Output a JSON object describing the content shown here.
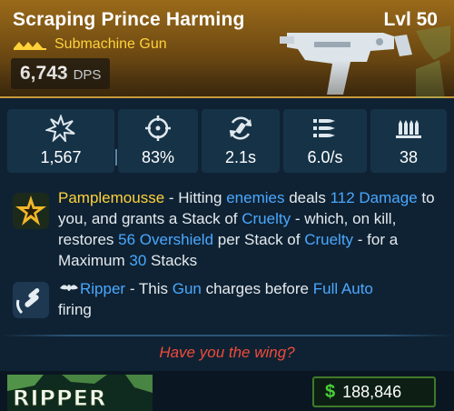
{
  "header": {
    "name": "Scraping Prince Harming",
    "level": "Lvl 50",
    "rarity_label": "Submachine Gun",
    "dps_value": "6,743",
    "dps_unit": "DPS"
  },
  "stats": [
    {
      "icon": "damage-burst-icon",
      "value": "1,567"
    },
    {
      "icon": "crosshair-icon",
      "value": "83%"
    },
    {
      "icon": "reload-icon",
      "value": "2.1s"
    },
    {
      "icon": "fire-rate-icon",
      "value": "6.0/s"
    },
    {
      "icon": "magazine-icon",
      "value": "38"
    }
  ],
  "perk1": {
    "icon": "star-badge-icon",
    "name": "Pamplemousse",
    "t1": " - Hitting ",
    "k1": "enemies",
    "t2": " deals ",
    "k2": "112",
    "k3": "Damage",
    "t3": " to you, and grants a Stack of ",
    "k4": "Cruelty",
    "t4": " - which, on kill, restores ",
    "k5": "56 Overshield",
    "t5": " per Stack of ",
    "k6": "Cruelty",
    "t6": " - for a Maximum ",
    "k7": "30",
    "t7": " Stacks"
  },
  "perk2": {
    "icon": "ripper-bullets-icon",
    "brand_icon": "ripper-brand-icon",
    "name": "Ripper",
    "t1": " - This ",
    "k1": "Gun",
    "t2": " charges before ",
    "k2": "Full Auto",
    "t3": "firing"
  },
  "flavor": "Have you the wing?",
  "footer": {
    "logo_icon": "ripper-logo-icon",
    "logo_text": "RIPPER",
    "price_sign": "$",
    "price_value": "188,846"
  },
  "colors": {
    "header": "#8a5e16",
    "rarity": "#ffd23a",
    "keyword": "#4aa8ff",
    "flavor": "#f04a3a",
    "price": "#49d23a"
  }
}
